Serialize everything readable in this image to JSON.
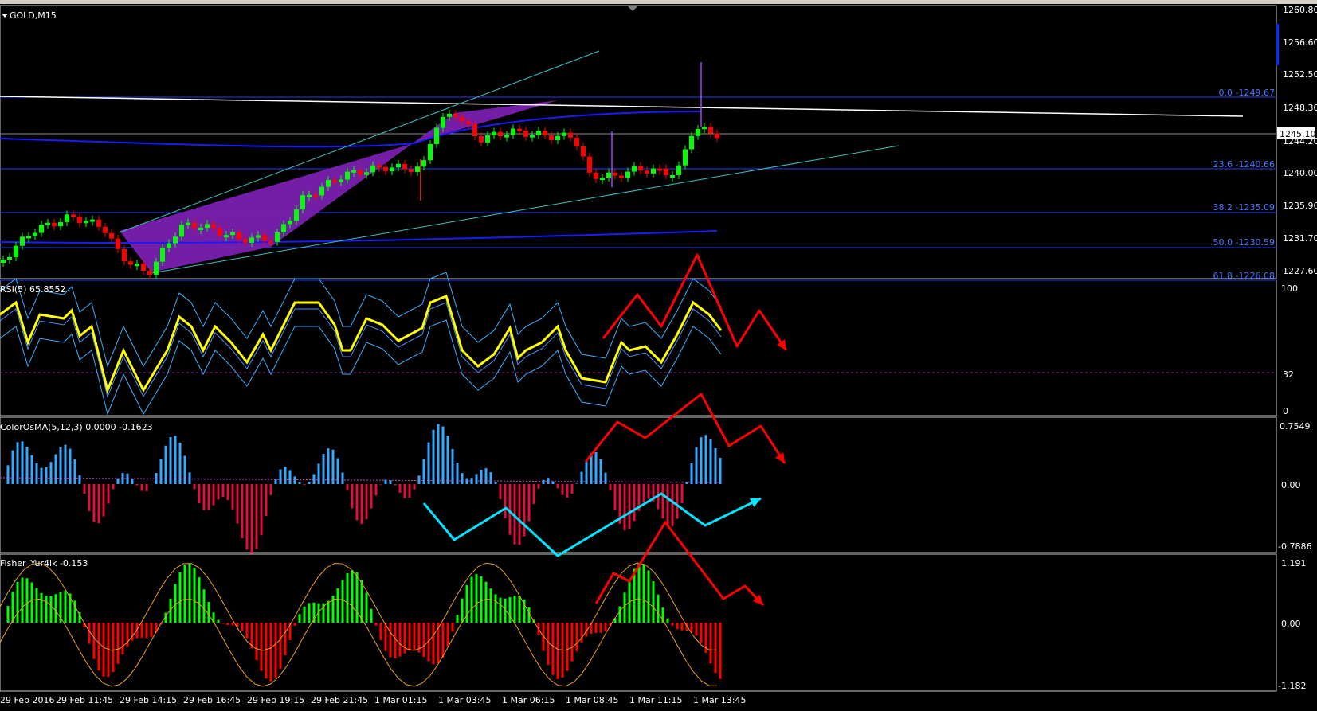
{
  "symbol_title": "GOLD,M15",
  "price_axis": [
    "1260.80",
    "1256.60",
    "1252.50",
    "1248.30",
    "1244.20",
    "1240.00",
    "1235.90",
    "1231.70",
    "1227.60"
  ],
  "current_price": "1245.10",
  "fib_levels": [
    {
      "label": "0.0 -1249.67"
    },
    {
      "label": "23.6 -1240.66"
    },
    {
      "label": "38.2 -1235.09"
    },
    {
      "label": "50.0 -1230.59"
    },
    {
      "label": "61.8 -1226.08"
    }
  ],
  "rsi": {
    "title": "RSI(5) 65.8552",
    "axis": [
      "100",
      "32",
      "0"
    ]
  },
  "osma": {
    "title": "ColorOsMA(5,12,3) 0.0000 -0.1623",
    "axis": [
      "0.7549",
      "0.00",
      "-0.7886"
    ]
  },
  "fisher": {
    "title": "Fisher_Yur4ik -0.153",
    "axis": [
      "1.191",
      "0.00",
      "-1.182"
    ]
  },
  "time_axis": [
    "29 Feb 2016",
    "29 Feb 11:45",
    "29 Feb 14:15",
    "29 Feb 16:45",
    "29 Feb 19:15",
    "29 Feb 21:45",
    "1 Mar 01:15",
    "1 Mar 03:45",
    "1 Mar 06:15",
    "1 Mar 08:45",
    "1 Mar 11:15",
    "1 Mar 13:45"
  ],
  "colors": {
    "bull": "#00ff00",
    "bear": "#ff0000",
    "rsi": "#ffff00",
    "osma_up": "#39a9ff",
    "osma_dn": "#e0103a",
    "arrow_red": "#ff0000",
    "arrow_cyan": "#00e5ff",
    "channel": "#7a20b0"
  }
}
